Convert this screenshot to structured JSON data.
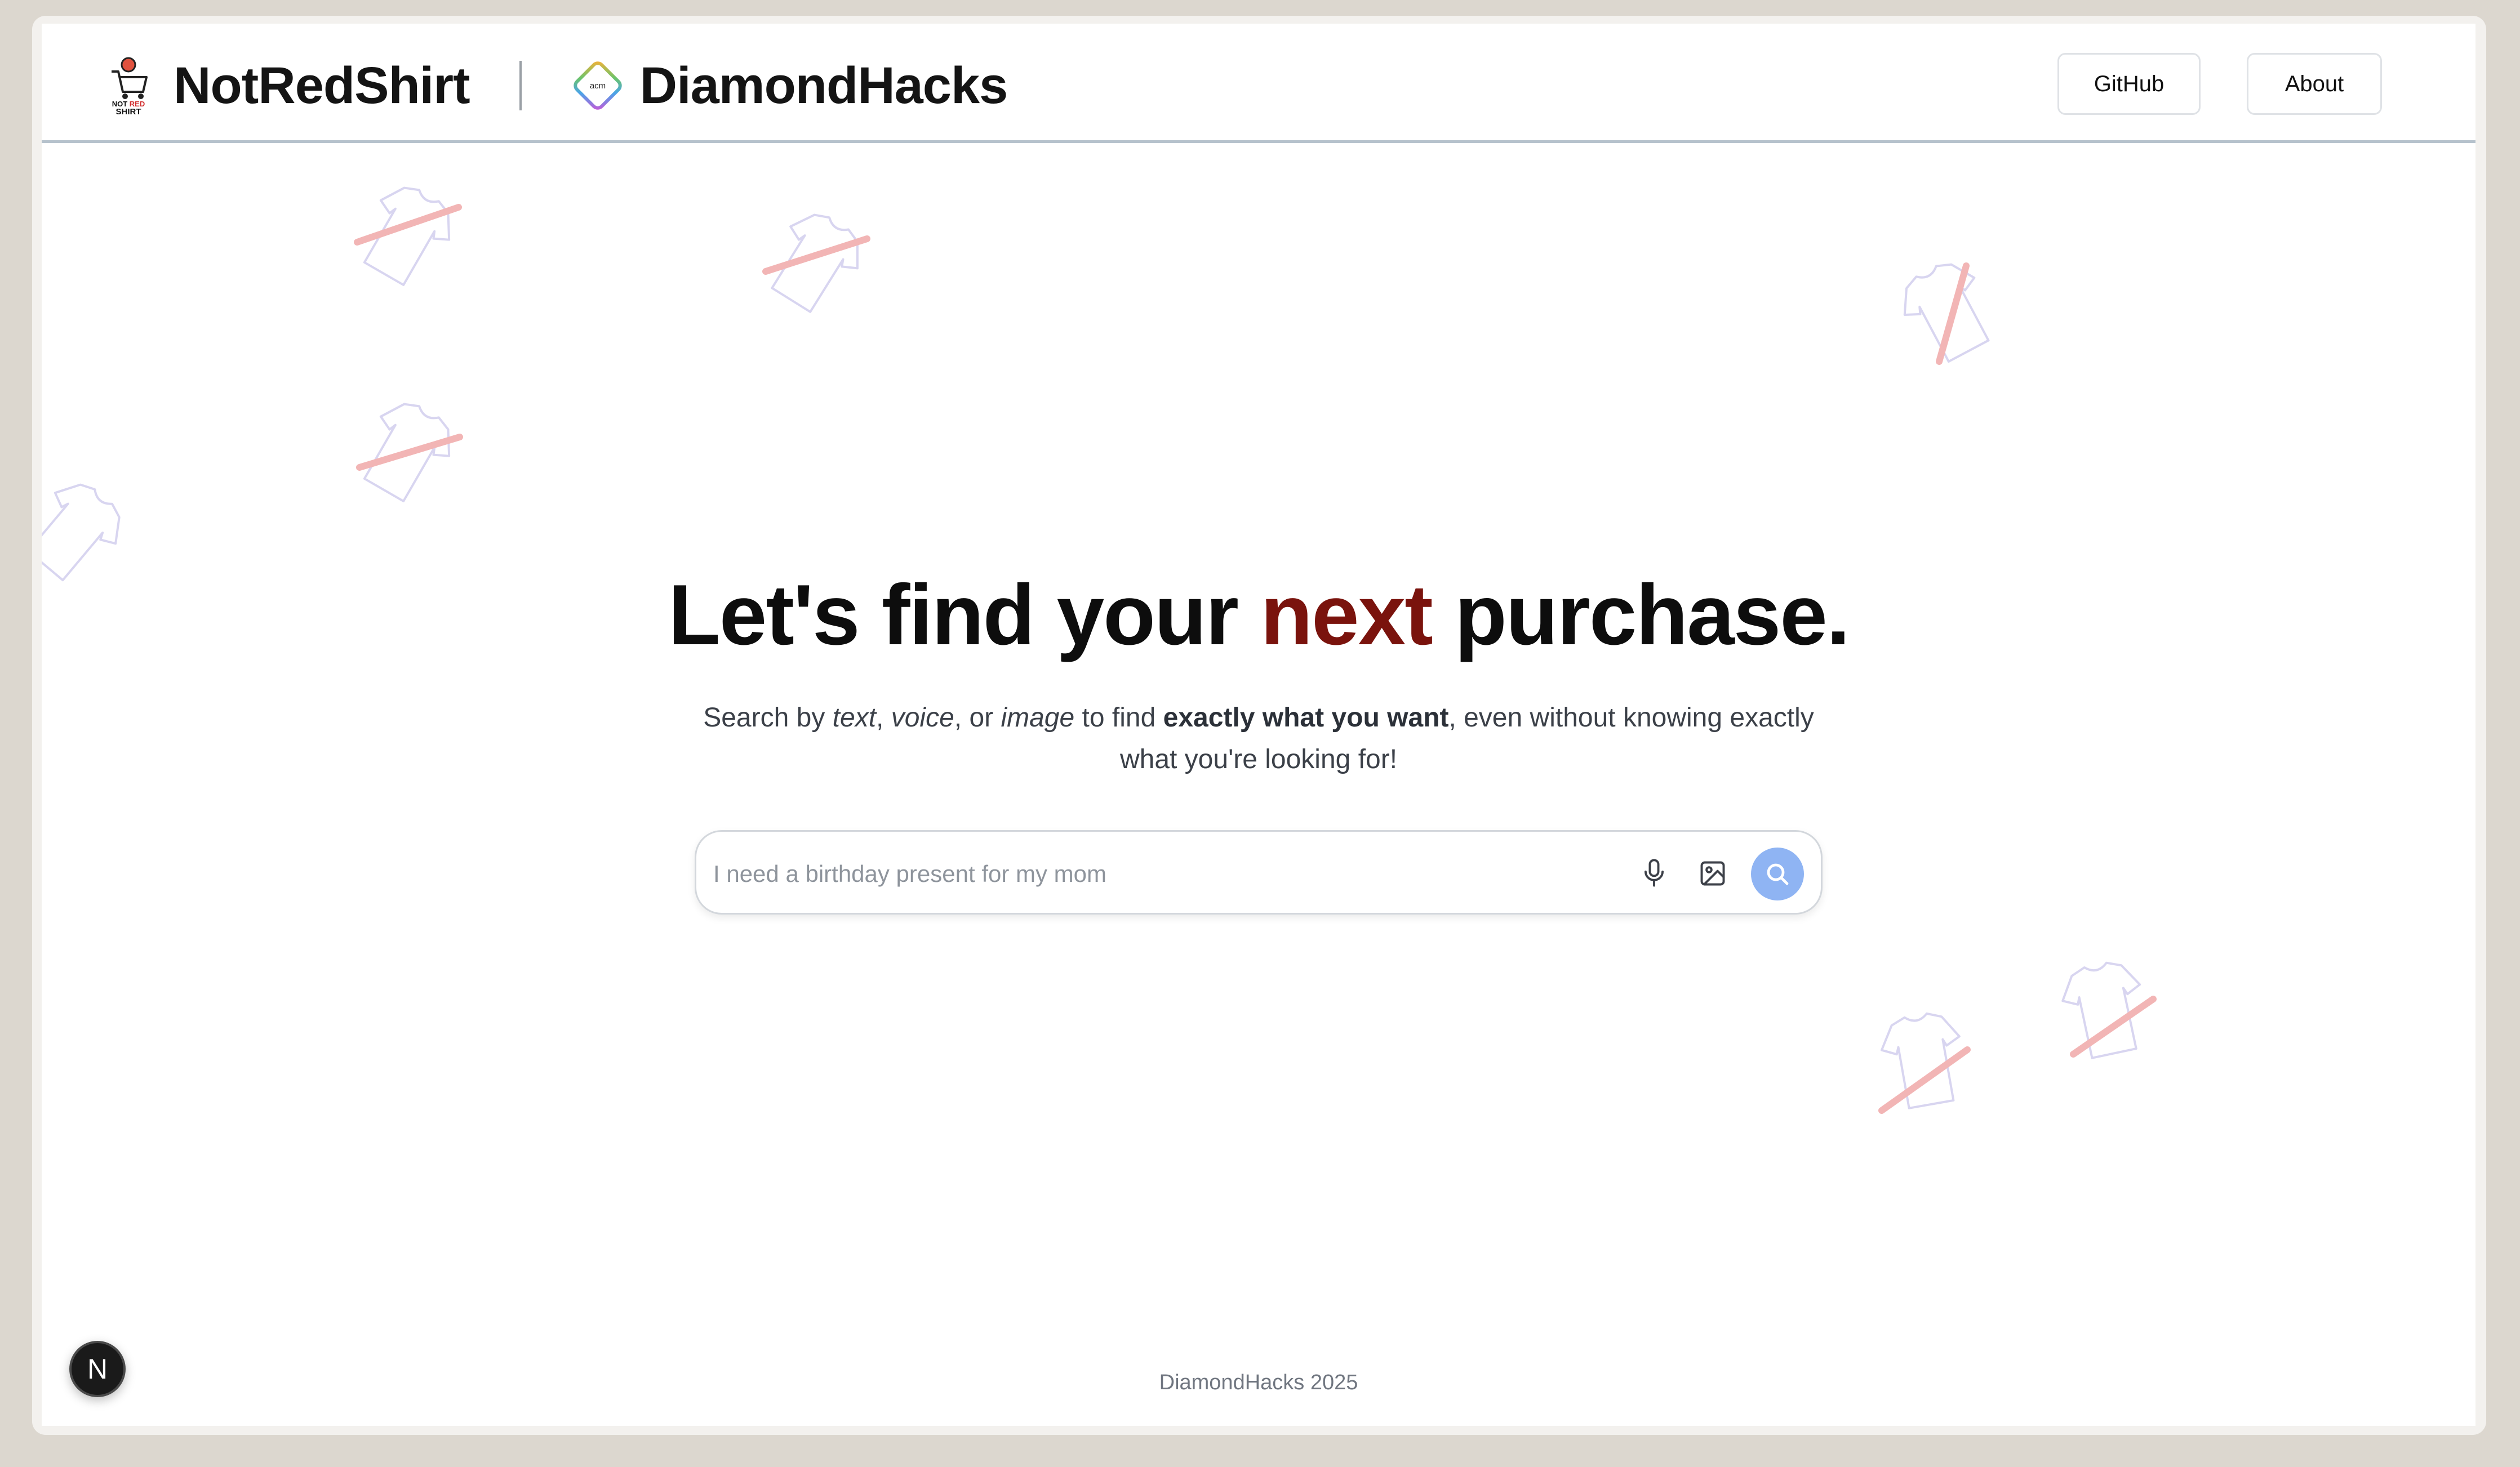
{
  "header": {
    "brand_name": "NotRedShirt",
    "brand_logo_text": "NOT RED SHIRT",
    "partner_name": "DiamondHacks",
    "partner_logo_text": "acm",
    "nav": {
      "github_label": "GitHub",
      "about_label": "About"
    }
  },
  "hero": {
    "headline_before": "Let's find your ",
    "headline_accent": "next",
    "headline_after": " purchase.",
    "sub_1": "Search by ",
    "sub_text": "text",
    "sub_2": ", ",
    "sub_voice": "voice",
    "sub_3": ", or ",
    "sub_image": "image",
    "sub_4": " to find ",
    "sub_bold": "exactly what you want",
    "sub_5": ", even without knowing exactly what you're looking for!"
  },
  "search": {
    "placeholder": "I need a birthday present for my mom",
    "mic_icon": "microphone-icon",
    "image_icon": "image-upload-icon",
    "search_icon": "search-icon"
  },
  "footer": {
    "text": "DiamondHacks 2025"
  },
  "dev_badge": {
    "letter": "N"
  },
  "colors": {
    "accent": "#7a130d",
    "search_button": "#8fb4f3",
    "header_border": "#b6c2cc",
    "slash": "#f2b5b5"
  }
}
